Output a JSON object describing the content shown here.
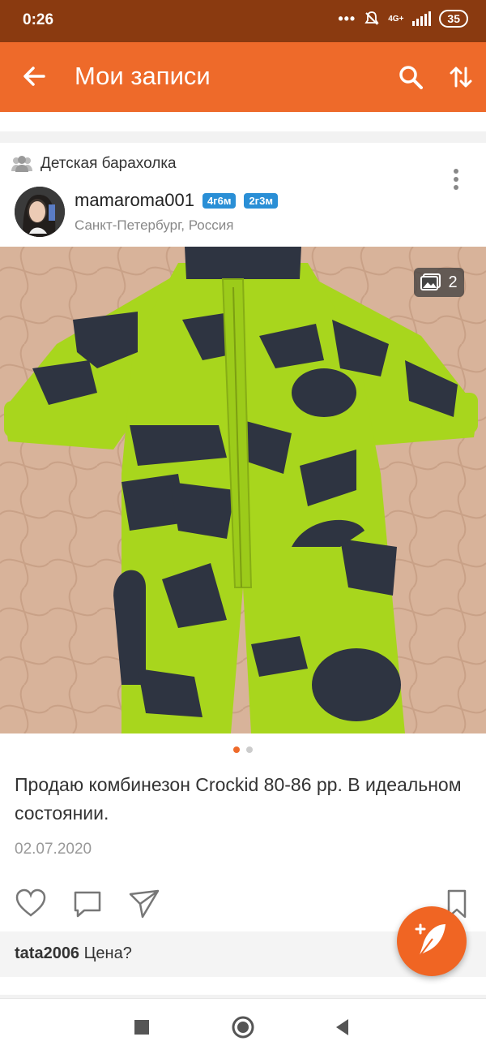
{
  "status_bar": {
    "time": "0:26",
    "network": "4G+",
    "battery": "35"
  },
  "toolbar": {
    "title": "Мои записи"
  },
  "post": {
    "group": "Детская барахолка",
    "author": "mamaroma001",
    "badges": [
      "4г6м",
      "2г3м"
    ],
    "location": "Санкт-Петербург, Россия",
    "photo_count": "2",
    "text": "Продаю комбинезон  Crockid 80-86 рр. В идеальном состоянии.",
    "date": "02.07.2020",
    "comment": {
      "user": "tata2006",
      "text": "Цена?"
    }
  },
  "colors": {
    "accent": "#ee6a2a",
    "status_bar": "#8a3a10",
    "badge": "#2a8fd6"
  }
}
